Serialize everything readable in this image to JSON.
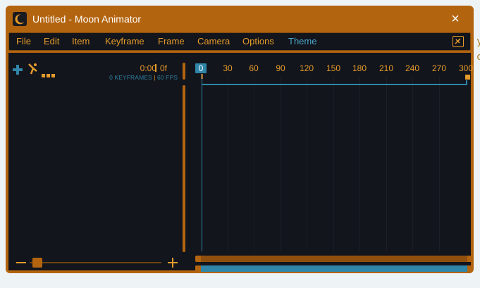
{
  "background": {
    "partial_text": "y",
    "partial_text_2": "o"
  },
  "window": {
    "title": "Untitled - Moon Animator",
    "close_label": "×",
    "accent": "#b3640f",
    "panel_bg": "#13151c"
  },
  "menu": {
    "items": [
      {
        "label": "File"
      },
      {
        "label": "Edit"
      },
      {
        "label": "Item"
      },
      {
        "label": "Keyframe"
      },
      {
        "label": "Frame"
      },
      {
        "label": "Camera"
      },
      {
        "label": "Options"
      },
      {
        "label": "Theme"
      }
    ],
    "toggle_icon": "collapse-box-icon"
  },
  "toolbar": {
    "icons": [
      "add-icon",
      "rig-bone-icon",
      "more-dots-icon"
    ],
    "time": "0:00",
    "frame": "0f",
    "keyframes": "0 KEYFRAMES",
    "fps": "60 FPS"
  },
  "timeline": {
    "ticks": [
      "0",
      "30",
      "60",
      "90",
      "120",
      "150",
      "180",
      "210",
      "240",
      "270",
      "300"
    ],
    "current_frame": "0",
    "end_frame": "300"
  },
  "zoom": {
    "minus_icon": "zoom-out-icon",
    "plus_icon": "zoom-in-icon"
  }
}
